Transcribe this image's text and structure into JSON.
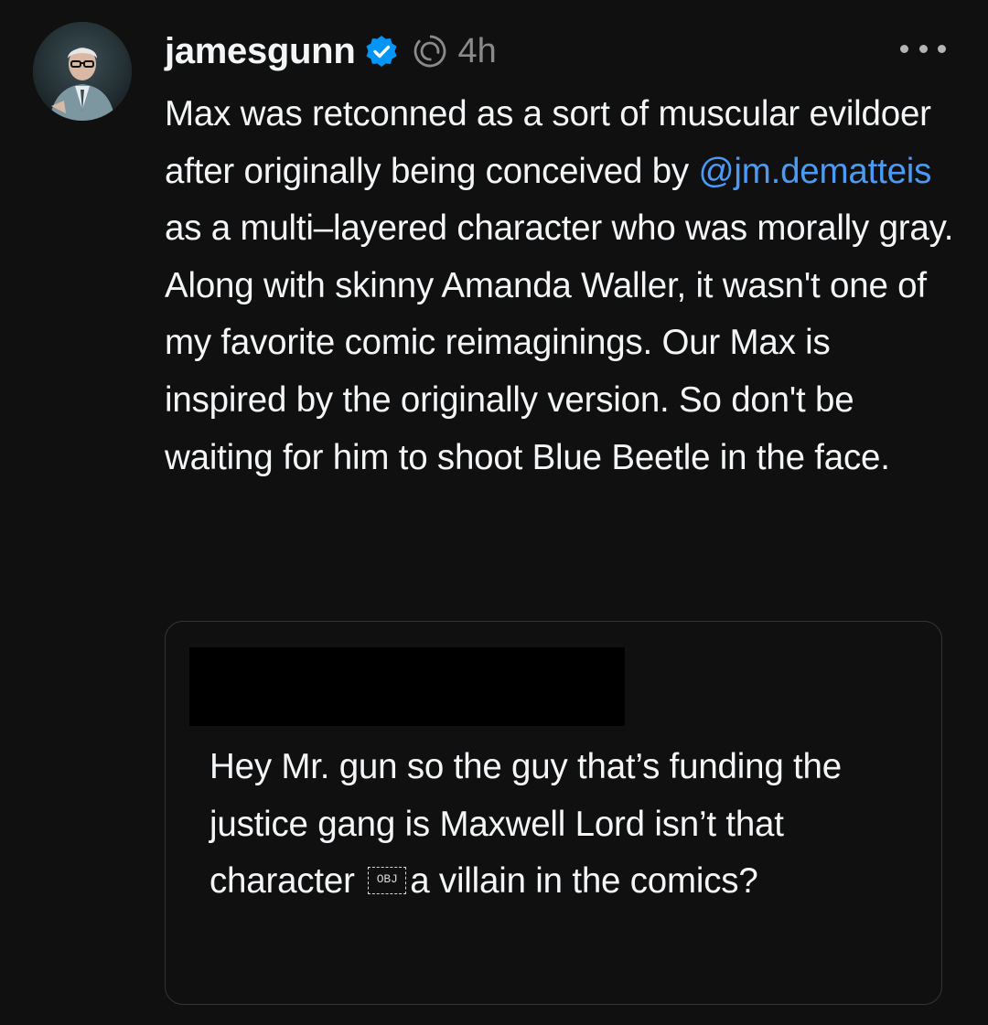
{
  "post": {
    "username": "jamesgunn",
    "time": "4h",
    "text_before_mention": "Max was retconned as a sort of muscular evildoer after originally being conceived by ",
    "mention": "@jm.dematteis",
    "text_after_mention": " as a multi–layered character who was morally gray. Along with skinny Amanda Waller, it wasn't one of my favorite comic reimaginings. Our Max is inspired by the originally version. So don't be waiting for him to shoot Blue Beetle in the face.",
    "icons": {
      "verified": "verified-badge-icon",
      "thread": "thread-spiral-icon",
      "more": "more-options-icon"
    }
  },
  "quote": {
    "text_before_obj": "Hey Mr. gun so the guy that’s funding the justice gang is Maxwell Lord isn’t that character ",
    "obj_glyph": "OBJ",
    "text_after_obj": "a villain in the comics?"
  },
  "colors": {
    "background": "#101010",
    "text": "#f3f5f7",
    "mention": "#4a9bf5",
    "verified": "#0095f6",
    "muted": "#8a8a8a",
    "card_border": "#333638"
  }
}
